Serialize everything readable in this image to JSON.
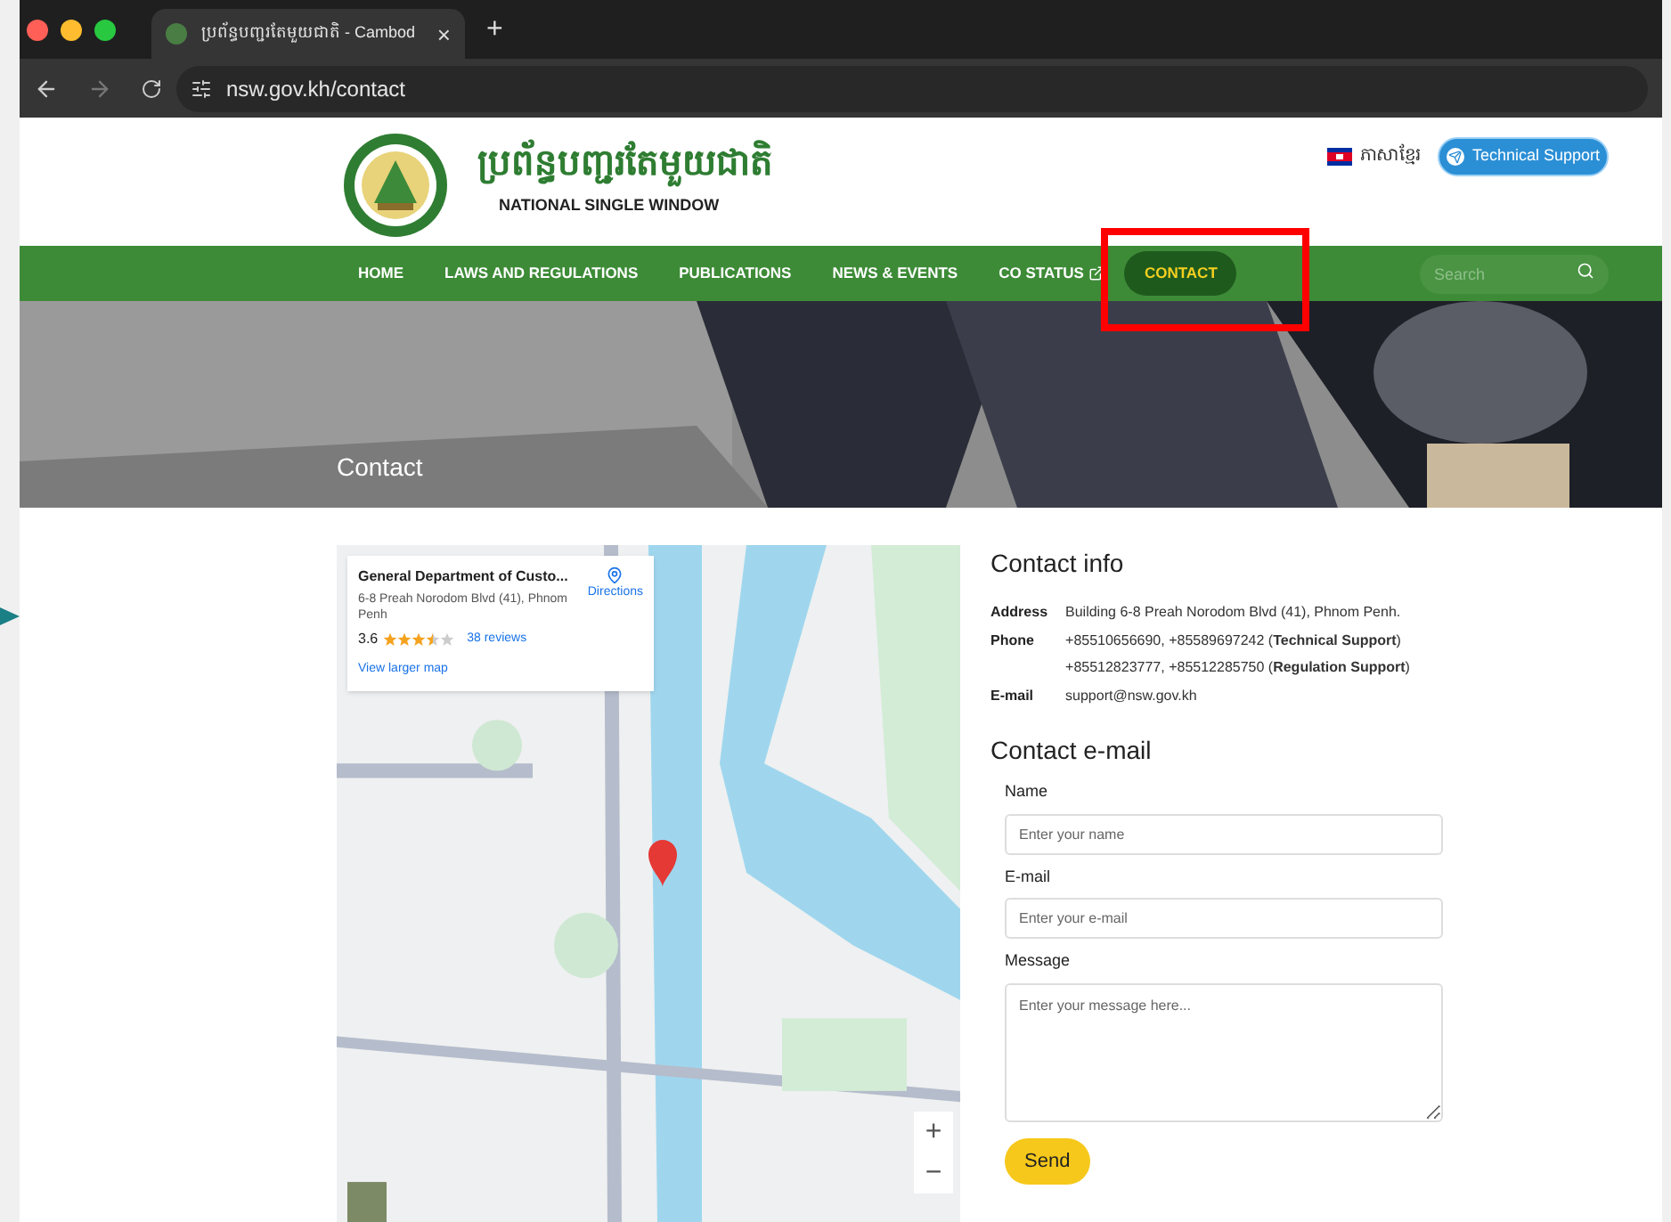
{
  "browser": {
    "tab_title": "ប្រព័ន្ធបញ្ជរតែមួយជាតិ - Cambod",
    "new_tab": "+",
    "close": "×",
    "url": "nsw.gov.kh/contact"
  },
  "header": {
    "logo_title": "ប្រព័ន្ធបញ្ជរតែមួយជាតិ",
    "logo_subtitle": "NATIONAL SINGLE WINDOW",
    "language": "ភាសាខ្មែរ",
    "support_button": "Technical Support"
  },
  "nav": {
    "items": [
      {
        "label": "HOME",
        "selected": false,
        "external": false
      },
      {
        "label": "LAWS AND REGULATIONS",
        "selected": false,
        "external": false
      },
      {
        "label": "PUBLICATIONS",
        "selected": false,
        "external": false
      },
      {
        "label": "NEWS & EVENTS",
        "selected": false,
        "external": false
      },
      {
        "label": "CO STATUS",
        "selected": false,
        "external": true
      },
      {
        "label": "CONTACT",
        "selected": true,
        "external": false
      }
    ],
    "search": {
      "placeholder": "Search"
    }
  },
  "hero": {
    "title": "Contact"
  },
  "map": {
    "card": {
      "title": "General Department of Custo...",
      "address": "6-8 Preah Norodom Blvd (41), Phnom Penh",
      "rating": "3.6",
      "stars": 3.5,
      "reviews": "38 reviews",
      "directions": "Directions",
      "larger_map": "View larger map"
    },
    "zoom_in": "+",
    "zoom_out": "−"
  },
  "contact_info": {
    "title": "Contact info",
    "rows": [
      {
        "label": "Address",
        "lines": [
          "Building 6-8 Preah Norodom Blvd (41), Phnom Penh."
        ]
      },
      {
        "label": "Phone",
        "lines": [
          "+85510656690, +85589697242 (**Technical Support**)",
          "+85512823777, +85512285750 (**Regulation Support**)"
        ]
      },
      {
        "label": "E-mail",
        "lines": [
          "support@nsw.gov.kh"
        ]
      }
    ]
  },
  "contact_form": {
    "title": "Contact e-mail",
    "fields": [
      {
        "kind": "input",
        "label": "Name",
        "placeholder": "Enter your name"
      },
      {
        "kind": "input",
        "label": "E-mail",
        "placeholder": "Enter your e-mail"
      },
      {
        "kind": "textarea",
        "label": "Message",
        "placeholder": "Enter your message here..."
      }
    ],
    "submit": "Send"
  }
}
